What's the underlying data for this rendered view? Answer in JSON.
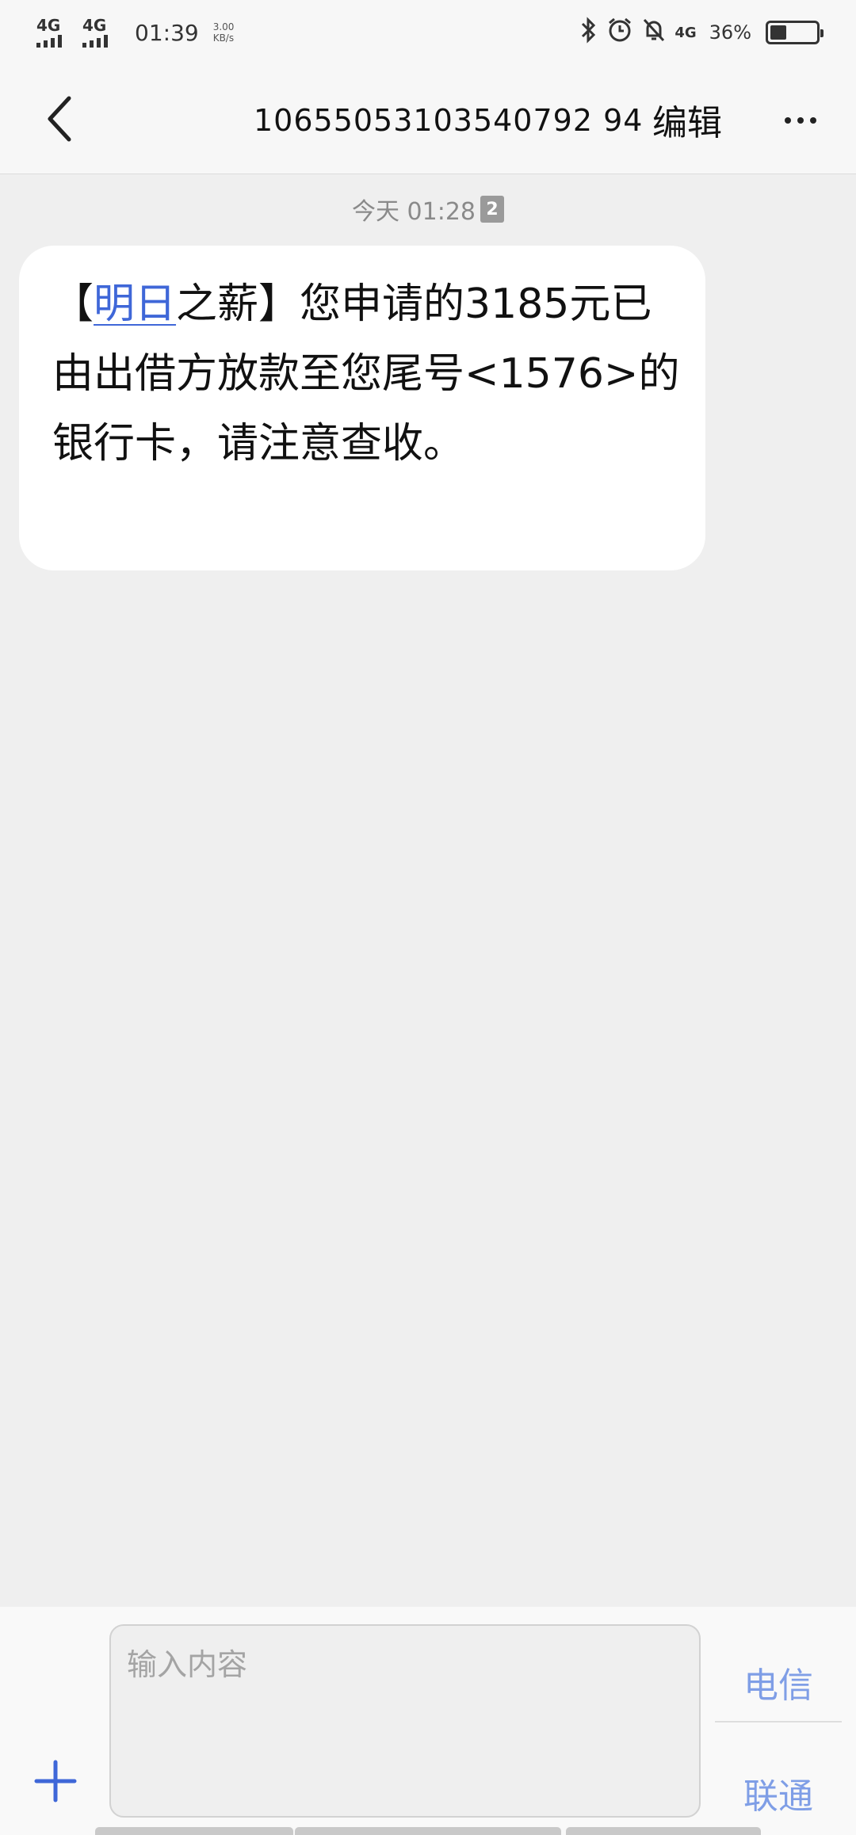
{
  "status_bar": {
    "sim1_network": "4G",
    "sim2_network": "4G",
    "time": "01:39",
    "speed_value": "3.00",
    "speed_unit": "KB/s",
    "battery_network": "4G",
    "battery_percent": "36%",
    "battery_level": 0.36
  },
  "header": {
    "contact_number": "10655053103540792 94",
    "edit_label": "编辑"
  },
  "thread": {
    "timestamp": "今天 01:28",
    "sim_badge": "2",
    "message": {
      "bracket_open": "【",
      "link_text": "明日",
      "after_link": "之薪】您申请的3185元已由出借方放款至您尾号<1576>的银行卡，请注意查收。"
    }
  },
  "composer": {
    "placeholder": "输入内容",
    "sim1_label": "电信",
    "sim2_label": "联通"
  }
}
